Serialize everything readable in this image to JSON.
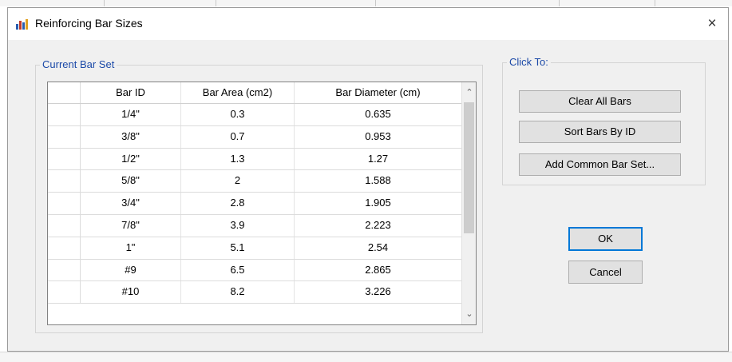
{
  "window": {
    "title": "Reinforcing Bar Sizes",
    "close_symbol": "×"
  },
  "current_bar_set": {
    "label": "Current Bar Set",
    "columns": [
      "Bar ID",
      "Bar Area  (cm2)",
      "Bar Diameter  (cm)"
    ],
    "rows": [
      [
        "1/4\"",
        "0.3",
        "0.635"
      ],
      [
        "3/8\"",
        "0.7",
        "0.953"
      ],
      [
        "1/2\"",
        "1.3",
        "1.27"
      ],
      [
        "5/8\"",
        "2",
        "1.588"
      ],
      [
        "3/4\"",
        "2.8",
        "1.905"
      ],
      [
        "7/8\"",
        "3.9",
        "2.223"
      ],
      [
        "1\"",
        "5.1",
        "2.54"
      ],
      [
        "#9",
        "6.5",
        "2.865"
      ],
      [
        "#10",
        "8.2",
        "3.226"
      ]
    ],
    "scroll_up": "⌃",
    "scroll_down": "⌄"
  },
  "click_to": {
    "label": "Click To:",
    "clear_all": "Clear All Bars",
    "sort_by_id": "Sort Bars By ID",
    "add_common": "Add Common Bar Set..."
  },
  "actions": {
    "ok": "OK",
    "cancel": "Cancel"
  },
  "colors": {
    "group_label": "#1c4aa8",
    "ok_border": "#0078d7"
  },
  "icons": {
    "app": "bar-chart-icon",
    "close": "close-icon",
    "scroll_up": "chevron-up-icon",
    "scroll_down": "chevron-down-icon"
  }
}
